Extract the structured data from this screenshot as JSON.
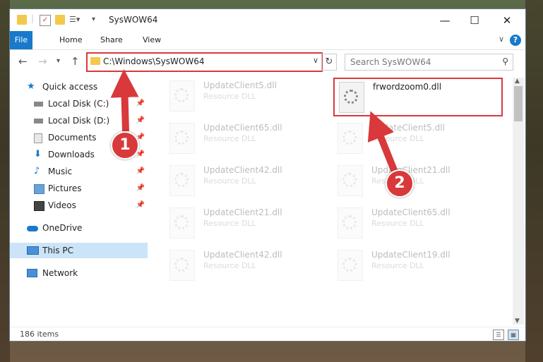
{
  "window": {
    "title": "SysWOW64",
    "controls": {
      "minimize": "—",
      "maximize": "☐",
      "close": "✕"
    }
  },
  "ribbon": {
    "tabs": [
      "File",
      "Home",
      "Share",
      "View"
    ],
    "help": "?"
  },
  "address": {
    "path": "C:\\Windows\\SysWOW64",
    "search_placeholder": "Search SysWOW64"
  },
  "nav": {
    "items": [
      {
        "label": "Quick access",
        "icon": "star-icon",
        "pinned": false
      },
      {
        "label": "Local Disk (C:)",
        "icon": "drive-icon",
        "pinned": true
      },
      {
        "label": "Local Disk (D:)",
        "icon": "drive-icon",
        "pinned": true
      },
      {
        "label": "Documents",
        "icon": "documents-icon",
        "pinned": true
      },
      {
        "label": "Downloads",
        "icon": "download-icon",
        "pinned": true
      },
      {
        "label": "Music",
        "icon": "music-icon",
        "pinned": true
      },
      {
        "label": "Pictures",
        "icon": "pictures-icon",
        "pinned": true
      },
      {
        "label": "Videos",
        "icon": "videos-icon",
        "pinned": true
      },
      {
        "label": "OneDrive",
        "icon": "cloud-icon",
        "pinned": false
      },
      {
        "label": "This PC",
        "icon": "computer-icon",
        "pinned": false,
        "selected": true
      },
      {
        "label": "Network",
        "icon": "network-icon",
        "pinned": false
      }
    ]
  },
  "files": [
    {
      "name": "UpdateClient5.dll",
      "type": "Resource DLL",
      "faded": true
    },
    {
      "name": "frwordzoom0.dll",
      "type": "",
      "faded": false,
      "highlighted": true
    },
    {
      "name": "UpdateClient65.dll",
      "type": "Resource DLL",
      "faded": true
    },
    {
      "name": "UpdateClient5.dll",
      "type": "Resource DLL",
      "faded": true
    },
    {
      "name": "UpdateClient42.dll",
      "type": "Resource DLL",
      "faded": true
    },
    {
      "name": "UpdateClient21.dll",
      "type": "Resource DLL",
      "faded": true
    },
    {
      "name": "UpdateClient21.dll",
      "type": "Resource DLL",
      "faded": true
    },
    {
      "name": "UpdateClient65.dll",
      "type": "Resource DLL",
      "faded": true
    },
    {
      "name": "UpdateClient42.dll",
      "type": "Resource DLL",
      "faded": true
    },
    {
      "name": "UpdateClient19.dll",
      "type": "Resource DLL",
      "faded": true
    }
  ],
  "status": {
    "item_count": "186 items"
  },
  "annotations": {
    "step1": "1",
    "step2": "2",
    "color": "#d9393b"
  }
}
